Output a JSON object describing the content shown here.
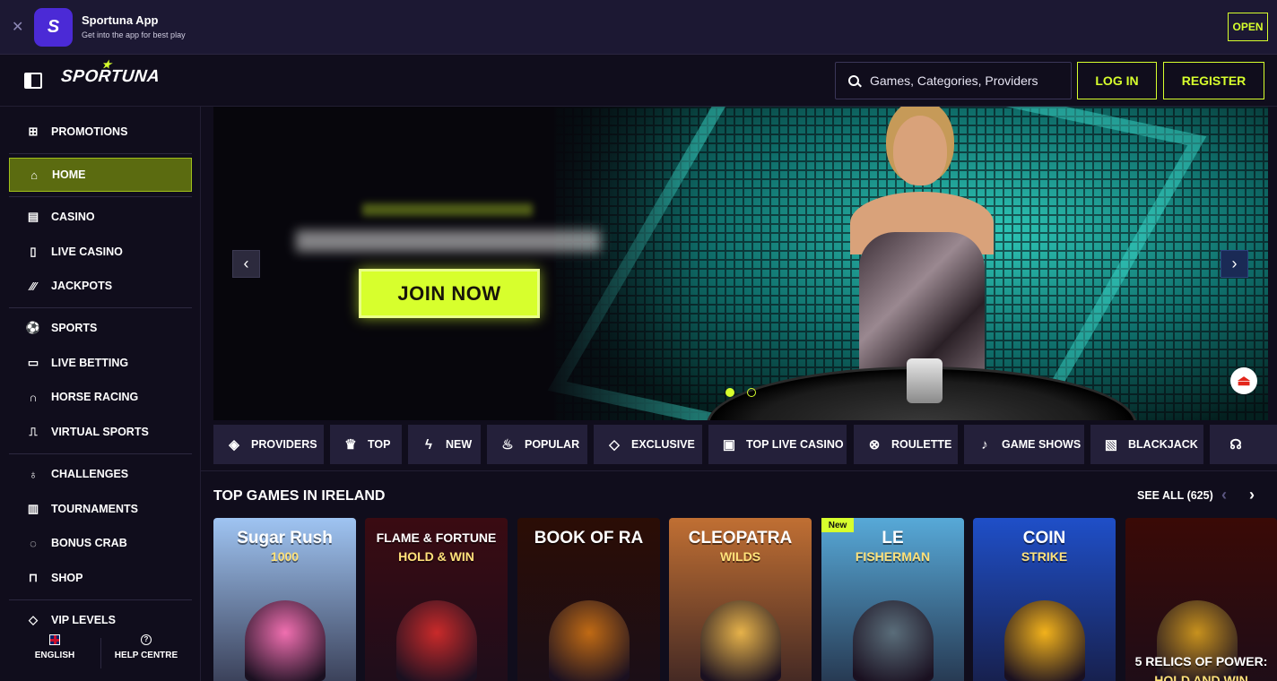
{
  "app_banner": {
    "close_icon": "close-icon",
    "app_icon_text": "S",
    "title": "Sportuna App",
    "subtitle": "Get into the app for best play",
    "open_label": "OPEN"
  },
  "header": {
    "logo": "SPORTUNA",
    "search_placeholder": "Games, Categories, Providers",
    "login_label": "LOG IN",
    "register_label": "REGISTER"
  },
  "sidebar": {
    "items": [
      {
        "label": "PROMOTIONS",
        "icon": "gift-icon"
      },
      {
        "label": "HOME",
        "icon": "home-icon",
        "active": true
      },
      {
        "label": "CASINO",
        "icon": "casino-icon"
      },
      {
        "label": "LIVE CASINO",
        "icon": "card-icon"
      },
      {
        "label": "JACKPOTS",
        "icon": "jackpot-icon"
      },
      {
        "label": "SPORTS",
        "icon": "football-icon"
      },
      {
        "label": "LIVE BETTING",
        "icon": "live-icon"
      },
      {
        "label": "HORSE RACING",
        "icon": "horseshoe-icon"
      },
      {
        "label": "VIRTUAL SPORTS",
        "icon": "gamepad-icon"
      },
      {
        "label": "CHALLENGES",
        "icon": "challenge-icon"
      },
      {
        "label": "TOURNAMENTS",
        "icon": "podium-icon"
      },
      {
        "label": "BONUS CRAB",
        "icon": "crab-icon"
      },
      {
        "label": "SHOP",
        "icon": "shop-icon"
      },
      {
        "label": "VIP LEVELS",
        "icon": "diamond-icon"
      }
    ],
    "footer": {
      "language": "ENGLISH",
      "help": "HELP CENTRE"
    }
  },
  "hero": {
    "cta_label": "JOIN NOW",
    "prev_icon": "chevron-left-icon",
    "next_icon": "chevron-right-icon",
    "slide_count": 2,
    "active_slide": 1
  },
  "categories": [
    {
      "label": "PROVIDERS",
      "icon": "layers-icon"
    },
    {
      "label": "TOP",
      "icon": "crown-icon"
    },
    {
      "label": "NEW",
      "icon": "lightning-icon"
    },
    {
      "label": "POPULAR",
      "icon": "flame-icon"
    },
    {
      "label": "EXCLUSIVE",
      "icon": "diamond-icon"
    },
    {
      "label": "TOP LIVE CASINO",
      "icon": "card-icon"
    },
    {
      "label": "ROULETTE",
      "icon": "roulette-icon"
    },
    {
      "label": "GAME SHOWS",
      "icon": "microphone-icon"
    },
    {
      "label": "BLACKJACK",
      "icon": "blackjack-icon"
    }
  ],
  "top_games": {
    "title": "TOP GAMES IN IRELAND",
    "see_all": "SEE ALL (625)",
    "badge_new": "New",
    "games": [
      {
        "name": "Sugar Rush 1000",
        "line1": "Sugar Rush",
        "line2": "1000",
        "bg": "#9fc4f2",
        "accent": "#f06fb0"
      },
      {
        "name": "Flame & Fortune Hold & Win",
        "line1": "FLAME & FORTUNE",
        "line2": "HOLD & WIN",
        "bg": "#3a0b12",
        "accent": "#c92a2a"
      },
      {
        "name": "Book of Ra",
        "line1": "BOOK OF RA",
        "line2": "",
        "bg": "#2b0d05",
        "accent": "#c06a14"
      },
      {
        "name": "Cleopatra Wilds",
        "line1": "CLEOPATRA",
        "line2": "WILDS",
        "bg": "#c06f33",
        "accent": "#e6b24a"
      },
      {
        "name": "Le Fisherman",
        "line1": "LE",
        "line2": "FISHERMAN",
        "bg": "#57a9d8",
        "accent": "#5a6d7a"
      },
      {
        "name": "Coin Strike Hold and Win 3x3",
        "line1": "COIN",
        "line2": "STRIKE",
        "bg": "#1f4fc8",
        "accent": "#f2b21c"
      },
      {
        "name": "5 Relics of Power Hold and Win",
        "line1": "5 RELICS OF POWER:",
        "line2": "HOLD AND WIN",
        "bg": "#3a0a06",
        "accent": "#c7911e"
      }
    ]
  },
  "colors": {
    "accent": "#d7ff2d",
    "bg": "#100d1c",
    "panel": "#24203a",
    "active_nav": "#5b6b10"
  }
}
